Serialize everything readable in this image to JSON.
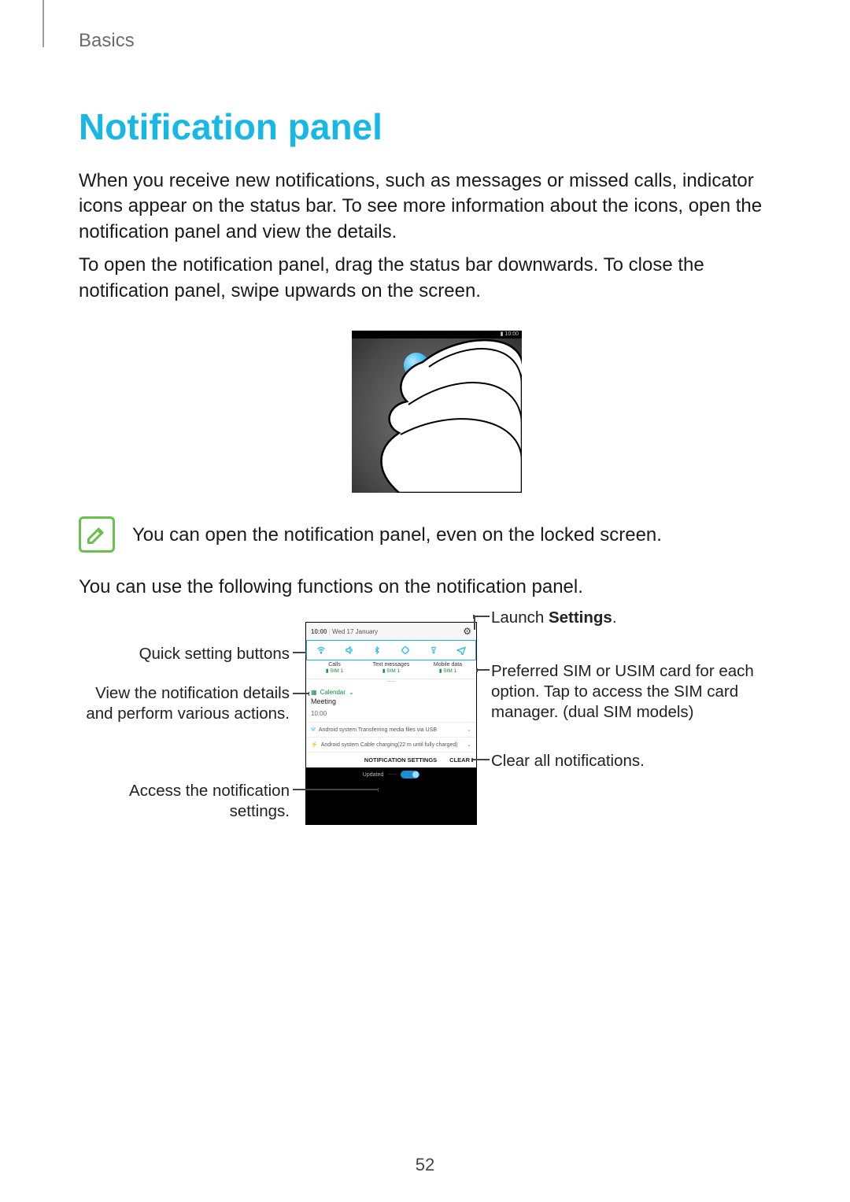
{
  "breadcrumb": "Basics",
  "title": "Notification panel",
  "para1": "When you receive new notifications, such as messages or missed calls, indicator icons appear on the status bar. To see more information about the icons, open the notification panel and view the details.",
  "para2": "To open the notification panel, drag the status bar downwards. To close the notification panel, swipe upwards on the screen.",
  "gesture_status_time": "10:00",
  "note": "You can open the notification panel, even on the locked screen.",
  "para3": "You can use the following functions on the notification panel.",
  "callouts": {
    "quick_settings": "Quick setting buttons",
    "details": "View the notification details and perform various actions.",
    "notif_settings": "Access the notification settings.",
    "launch_settings_pre": "Launch ",
    "launch_settings_bold": "Settings",
    "launch_settings_post": ".",
    "sim": "Preferred SIM or USIM card for each option. Tap to access the SIM card manager. (dual SIM models)",
    "clear": "Clear all notifications."
  },
  "phone": {
    "time": "10:00",
    "date": "Wed 17 January",
    "sim_cols": {
      "calls": "Calls",
      "texts": "Text messages",
      "data": "Mobile data",
      "sim1": "SIM 1"
    },
    "calendar_label": "Calendar",
    "meeting_title": "Meeting",
    "meeting_time": "10:00",
    "sys1": "Android system  Transferring media files via USB",
    "sys2": "Android system  Cable charging(22 m until fully charged)",
    "footer_settings": "NOTIFICATION SETTINGS",
    "footer_clear": "CLEAR",
    "updated": "Updated"
  },
  "page_number": "52"
}
